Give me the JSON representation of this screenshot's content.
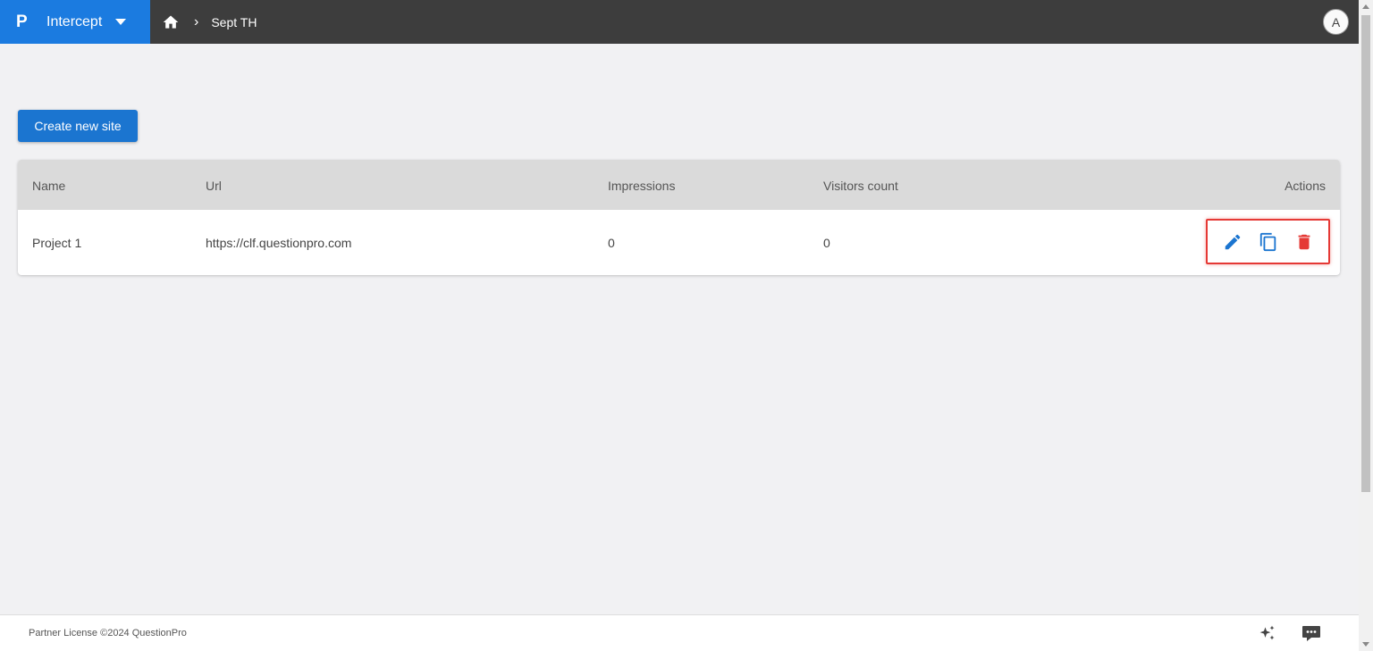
{
  "app": {
    "logo": "P",
    "name": "Intercept"
  },
  "breadcrumb": {
    "current": "Sept TH"
  },
  "user": {
    "avatar_initial": "A"
  },
  "toolbar": {
    "create_label": "Create new site"
  },
  "table": {
    "headers": {
      "name": "Name",
      "url": "Url",
      "impressions": "Impressions",
      "visitors": "Visitors count",
      "actions": "Actions"
    },
    "rows": [
      {
        "name": "Project 1",
        "url": "https://clf.questionpro.com",
        "impressions": "0",
        "visitors": "0"
      }
    ],
    "action_icons": [
      "edit-icon",
      "copy-icon",
      "delete-icon"
    ]
  },
  "footer": {
    "text": "Partner License ©2024 QuestionPro"
  },
  "colors": {
    "primary": "#1b75d0",
    "topbar": "#3d3d3d",
    "danger": "#e53935",
    "highlight": "#e53935"
  }
}
